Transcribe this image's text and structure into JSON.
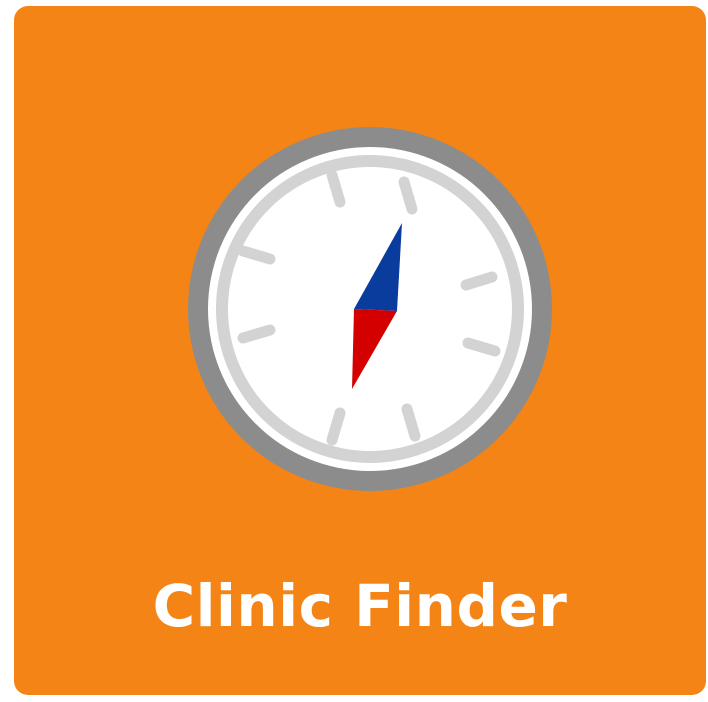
{
  "tile": {
    "label": "Clinic Finder",
    "icon": "compass-icon",
    "colors": {
      "background": "#F48415",
      "text": "#FFFFFF",
      "ring": "#8C8C8C",
      "face": "#FFFFFF",
      "ticks": "#D3D3D3",
      "needle_north": "#0A3C9E",
      "needle_south": "#D40000"
    }
  }
}
